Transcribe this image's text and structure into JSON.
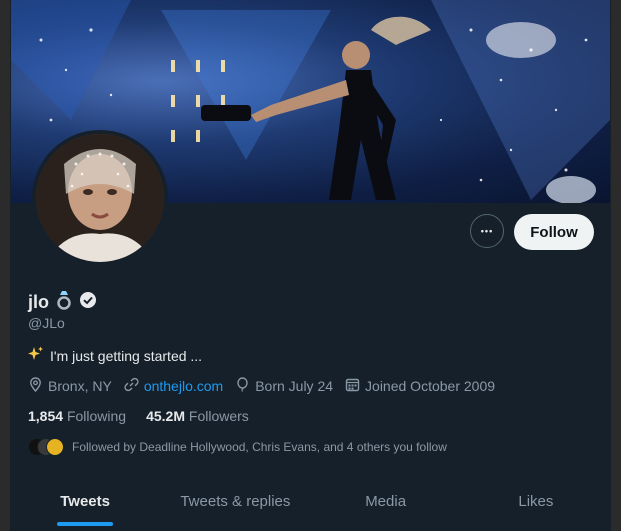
{
  "profile": {
    "display_name": "jlo",
    "name_badge_icon": "ring-emoji-icon",
    "verified_icon": "verified-badge-icon",
    "handle": "@JLo",
    "bio_emoji_icon": "sparkles-icon",
    "bio_text": "I'm just getting started ...",
    "location": "Bronx, NY",
    "website": "onthejlo.com",
    "birthday": "Born July 24",
    "joined": "Joined October 2009",
    "following_count": "1,854",
    "following_label": "Following",
    "followers_count": "45.2M",
    "followers_label": "Followers",
    "followed_by": "Followed by Deadline Hollywood, Chris Evans, and 4 others you follow"
  },
  "actions": {
    "more_label": "•••",
    "follow_label": "Follow"
  },
  "tabs": [
    {
      "label": "Tweets",
      "active": true
    },
    {
      "label": "Tweets & replies",
      "active": false
    },
    {
      "label": "Media",
      "active": false
    },
    {
      "label": "Likes",
      "active": false
    }
  ],
  "colors": {
    "background": "#15202b",
    "accent": "#1d9bf0",
    "muted_text": "#8b98a5",
    "primary_text": "#e7e9ea",
    "follow_button_bg": "#eff3f4"
  }
}
